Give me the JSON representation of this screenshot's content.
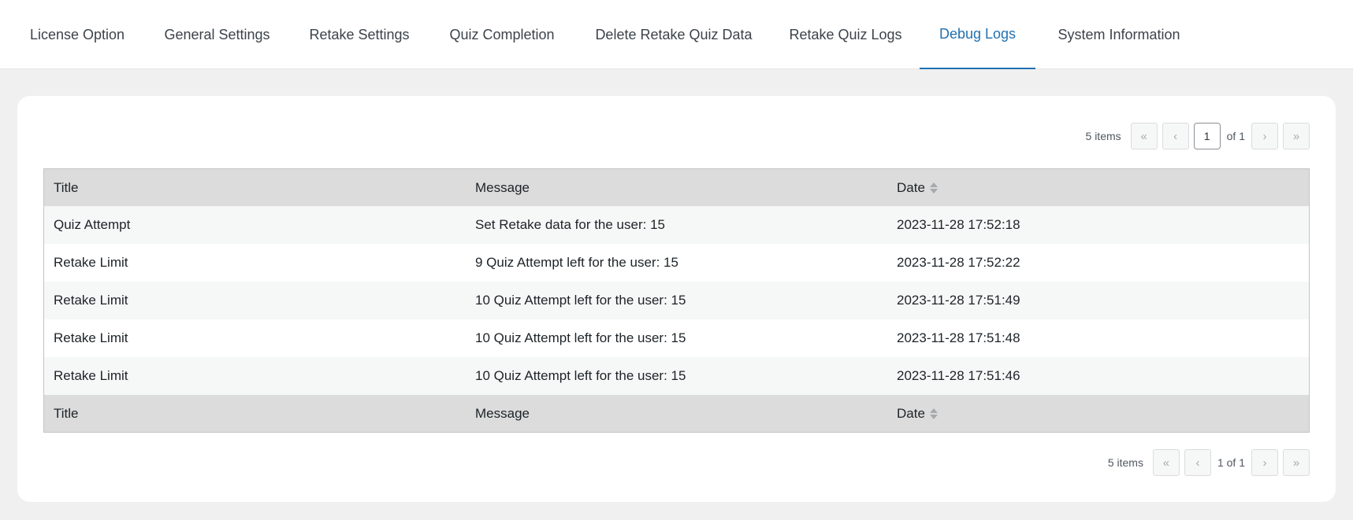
{
  "tabs": [
    {
      "label": "License Option",
      "active": false
    },
    {
      "label": "General Settings",
      "active": false
    },
    {
      "label": "Retake Settings",
      "active": false
    },
    {
      "label": "Quiz Completion",
      "active": false
    },
    {
      "label": "Delete Retake Quiz Data",
      "active": false
    },
    {
      "label": "Retake Quiz Logs",
      "active": false
    },
    {
      "label": "Debug Logs",
      "active": true
    },
    {
      "label": "System Information",
      "active": false
    }
  ],
  "pagination_top": {
    "items_text": "5 items",
    "first": "«",
    "prev": "‹",
    "current_page": "1",
    "of_text": "of 1",
    "next": "›",
    "last": "»"
  },
  "pagination_bottom": {
    "items_text": "5 items",
    "first": "«",
    "prev": "‹",
    "page_text": "1 of 1",
    "next": "›",
    "last": "»"
  },
  "table": {
    "columns": [
      "Title",
      "Message",
      "Date"
    ],
    "rows": [
      {
        "title": "Quiz Attempt",
        "message": "Set Retake data for the user: 15",
        "date": "2023-11-28 17:52:18"
      },
      {
        "title": "Retake Limit",
        "message": "9 Quiz Attempt left for the user: 15",
        "date": "2023-11-28 17:52:22"
      },
      {
        "title": "Retake Limit",
        "message": "10 Quiz Attempt left for the user: 15",
        "date": "2023-11-28 17:51:49"
      },
      {
        "title": "Retake Limit",
        "message": "10 Quiz Attempt left for the user: 15",
        "date": "2023-11-28 17:51:48"
      },
      {
        "title": "Retake Limit",
        "message": "10 Quiz Attempt left for the user: 15",
        "date": "2023-11-28 17:51:46"
      }
    ]
  },
  "colors": {
    "accent": "#2271b1",
    "header_bg": "#dcdcdc",
    "page_bg": "#f0f0f1"
  }
}
